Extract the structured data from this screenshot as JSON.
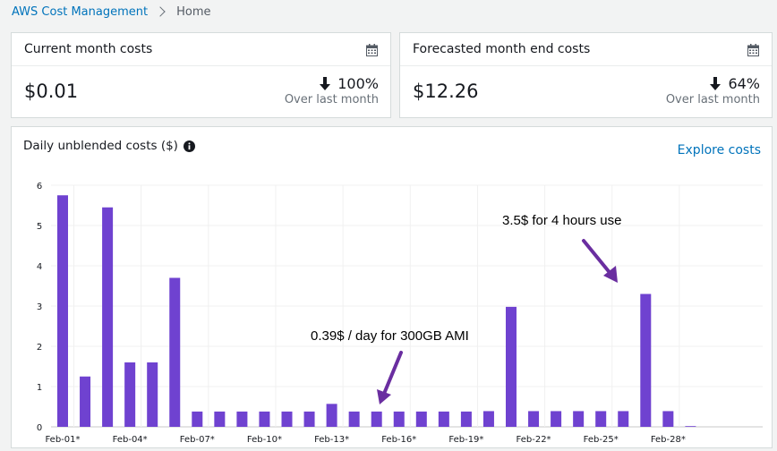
{
  "breadcrumb": {
    "root": "AWS Cost Management",
    "current": "Home"
  },
  "current_card": {
    "title": "Current month costs",
    "value": "$0.01",
    "change": "100%",
    "change_label": "Over last month"
  },
  "forecast_card": {
    "title": "Forecasted month end costs",
    "value": "$12.26",
    "change": "64%",
    "change_label": "Over last month"
  },
  "chart_card": {
    "title": "Daily unblended costs ($)",
    "explore_link": "Explore costs",
    "annotations": [
      {
        "text": "3.5$ for 4 hours use"
      },
      {
        "text": "0.39$ / day for 300GB AMI"
      }
    ]
  },
  "colors": {
    "bar": "#6f42d0",
    "arrow": "#6a2ea0",
    "link": "#0073bb"
  },
  "chart_data": {
    "type": "bar",
    "title": "Daily unblended costs ($)",
    "xlabel": "",
    "ylabel": "",
    "ylim": [
      0,
      6
    ],
    "yticks": [
      0,
      1,
      2,
      3,
      4,
      5,
      6
    ],
    "grid": true,
    "categories": [
      "Feb-01*",
      "Feb-02*",
      "Feb-03*",
      "Feb-04*",
      "Feb-05*",
      "Feb-06*",
      "Feb-07*",
      "Feb-08*",
      "Feb-09*",
      "Feb-10*",
      "Feb-11*",
      "Feb-12*",
      "Feb-13*",
      "Feb-14*",
      "Feb-15*",
      "Feb-16*",
      "Feb-17*",
      "Feb-18*",
      "Feb-19*",
      "Feb-20*",
      "Feb-21*",
      "Feb-22*",
      "Feb-23*",
      "Feb-24*",
      "Feb-25*",
      "Feb-26*",
      "Feb-27*",
      "Feb-28*",
      "Feb-29*"
    ],
    "tick_labels": [
      "Feb-01*",
      "Feb-04*",
      "Feb-07*",
      "Feb-10*",
      "Feb-13*",
      "Feb-16*",
      "Feb-19*",
      "Feb-22*",
      "Feb-25*",
      "Feb-28*"
    ],
    "values": [
      5.75,
      1.25,
      5.45,
      1.6,
      1.6,
      3.7,
      0.38,
      0.38,
      0.38,
      0.38,
      0.38,
      0.38,
      0.57,
      0.38,
      0.38,
      0.38,
      0.38,
      0.38,
      0.38,
      0.39,
      2.98,
      0.39,
      0.39,
      0.39,
      0.39,
      0.39,
      3.3,
      0.39,
      0.01
    ]
  }
}
